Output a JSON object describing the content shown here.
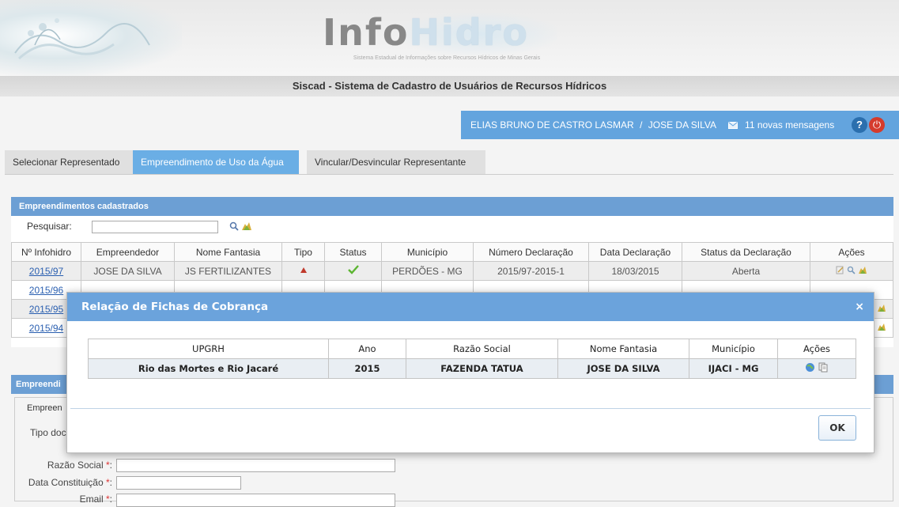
{
  "header": {
    "logo_info": "Info",
    "logo_hidro": "Hidro",
    "logo_subtitle": "Sistema Estadual de Informações sobre Recursos Hídricos de Minas Gerais",
    "system_title": "Siscad - Sistema de Cadastro de Usuários de Recursos Hídricos"
  },
  "userbar": {
    "user_name": "ELIAS BRUNO DE CASTRO LASMAR",
    "separator": "/",
    "represented": "JOSE DA SILVA",
    "messages": "11 novas mensagens",
    "help_label": "?",
    "power_label": "⏻"
  },
  "tabs": [
    {
      "label": "Selecionar Representado",
      "active": false
    },
    {
      "label": "Empreendimento de Uso da Água",
      "active": true
    },
    {
      "label": "Vincular/Desvincular Representante",
      "active": false
    }
  ],
  "panel": {
    "title": "Empreendimentos cadastrados",
    "search_label": "Pesquisar:",
    "search_value": "",
    "columns": [
      "Nº Infohidro",
      "Empreendedor",
      "Nome Fantasia",
      "Tipo",
      "Status",
      "Município",
      "Número Declaração",
      "Data Declaração",
      "Status da Declaração",
      "Ações"
    ],
    "rows": [
      {
        "id": "2015/97",
        "empreendedor": "JOSE DA SILVA",
        "fantasia": "JS FERTILIZANTES",
        "municipio": "PERDÕES - MG",
        "numero": "2015/97-2015-1",
        "data": "18/03/2015",
        "status_decl": "Aberta"
      },
      {
        "id": "2015/96"
      },
      {
        "id": "2015/95"
      },
      {
        "id": "2015/94"
      }
    ]
  },
  "form": {
    "section_title": "Empreendi",
    "legend": "Empreen",
    "tipo_doc_label": "Tipo doc",
    "razao_label": "Razão Social",
    "data_label": "Data Constituição",
    "email_label": "Email",
    "required_mark": "*",
    "colon": ":"
  },
  "modal": {
    "title": "Relação de Fichas de Cobrança",
    "close": "×",
    "columns": [
      "UPGRH",
      "Ano",
      "Razão Social",
      "Nome Fantasia",
      "Município",
      "Ações"
    ],
    "rows": [
      {
        "upgrh": "Rio das Mortes e Rio Jacaré",
        "ano": "2015",
        "razao": "FAZENDA TATUA",
        "fantasia": "JOSE DA SILVA",
        "municipio": "IJACI - MG"
      }
    ],
    "ok_label": "OK"
  },
  "colors": {
    "accent": "#6ba3dc",
    "userbar": "#63a4de",
    "status_ok": "#5cb531",
    "power": "#d53b2c"
  }
}
